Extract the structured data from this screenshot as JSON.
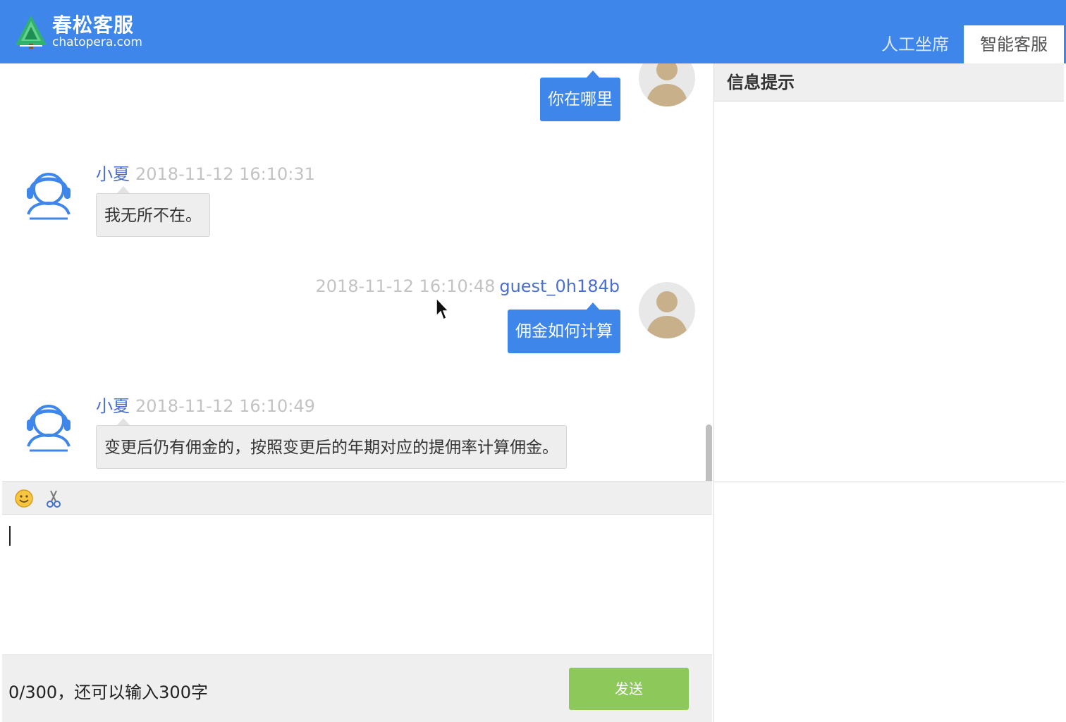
{
  "brand": {
    "title": "春松客服",
    "subtitle": "chatopera.com"
  },
  "tabs": [
    {
      "label": "人工坐席",
      "active": false
    },
    {
      "label": "智能客服",
      "active": true
    }
  ],
  "messages": [
    {
      "direction": "out",
      "text": "你在哪里"
    },
    {
      "direction": "in",
      "name": "小夏",
      "time": "2018-11-12 16:10:31",
      "text": "我无所不在。"
    },
    {
      "direction": "out",
      "name": "guest_0h184b",
      "time": "2018-11-12 16:10:48",
      "text": "佣金如何计算"
    },
    {
      "direction": "in",
      "name": "小夏",
      "time": "2018-11-12 16:10:49",
      "text": "变更后仍有佣金的，按照变更后的年期对应的提佣率计算佣金。"
    }
  ],
  "toolbar": {
    "icons": [
      "emoji-icon",
      "scissors-icon"
    ]
  },
  "composer": {
    "value": "",
    "counter": "0/300，还可以输入300字",
    "send_label": "发送"
  },
  "info_panel": {
    "title": "信息提示"
  },
  "colors": {
    "brand": "#3f86ea",
    "send": "#8dc85a",
    "name": "#4a6fd1"
  }
}
